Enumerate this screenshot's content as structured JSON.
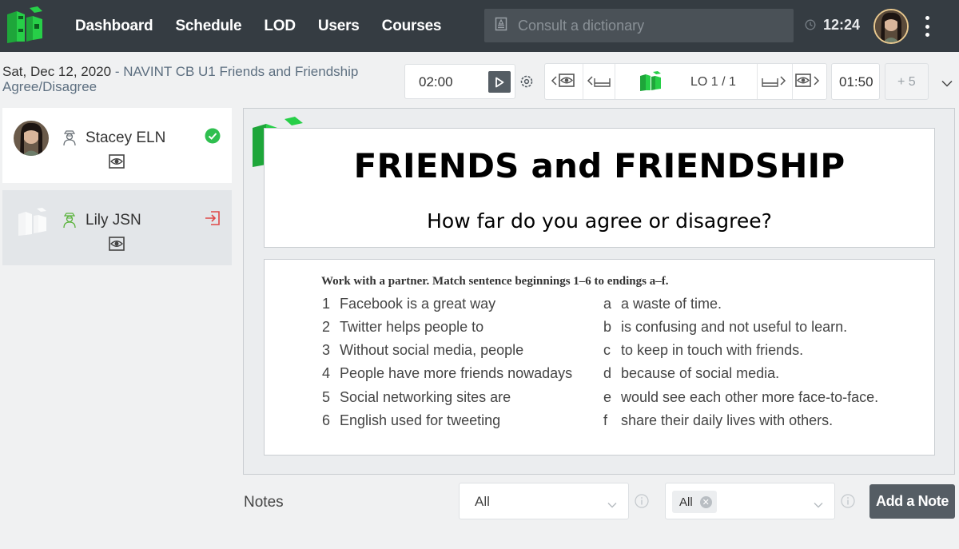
{
  "nav": {
    "items": [
      {
        "label": "Dashboard"
      },
      {
        "label": "Schedule"
      },
      {
        "label": "LOD"
      },
      {
        "label": "Users"
      },
      {
        "label": "Courses"
      }
    ],
    "search_placeholder": "Consult a dictionary",
    "time": "12:24"
  },
  "session": {
    "date": "Sat, Dec 12, 2020",
    "separator": " - ",
    "course": "NAVINT CB U1 Friends and Friendship Agree/Disagree"
  },
  "toolbar": {
    "timer_left": "02:00",
    "lo_position": "LO 1 / 1",
    "timer_right": "01:50",
    "plus_time": "+ 5"
  },
  "students": [
    {
      "name": "Stacey ELN",
      "status": "present"
    },
    {
      "name": "Lily JSN",
      "status": "left"
    }
  ],
  "slide": {
    "title": "FRIENDS and FRIENDSHIP",
    "subtitle": "How far do you agree or disagree?"
  },
  "exercise": {
    "instruction": "Work with a partner. Match sentence beginnings 1–6 to endings a–f.",
    "beginnings": [
      {
        "n": "1",
        "text": "Facebook is a great way"
      },
      {
        "n": "2",
        "text": "Twitter helps people to"
      },
      {
        "n": "3",
        "text": "Without social media, people"
      },
      {
        "n": "4",
        "text": "People have more friends nowadays"
      },
      {
        "n": "5",
        "text": "Social networking sites are"
      },
      {
        "n": "6",
        "text": "English used for tweeting"
      }
    ],
    "endings": [
      {
        "n": "a",
        "text": "a waste of time."
      },
      {
        "n": "b",
        "text": "is confusing and not useful to learn."
      },
      {
        "n": "c",
        "text": "to keep in touch with friends."
      },
      {
        "n": "d",
        "text": "because of social media."
      },
      {
        "n": "e",
        "text": "would see each other more face-to-face."
      },
      {
        "n": "f",
        "text": "share their daily lives with others."
      }
    ]
  },
  "notes": {
    "label": "Notes",
    "filter1_value": "All",
    "filter2_chip": "All",
    "add_button": "Add a Note"
  },
  "colors": {
    "navbar": "#353c42",
    "brand_green": "#22c03c",
    "check_green": "#2fbf4f",
    "exit_red": "#e04848",
    "button_dark": "#555d64"
  }
}
